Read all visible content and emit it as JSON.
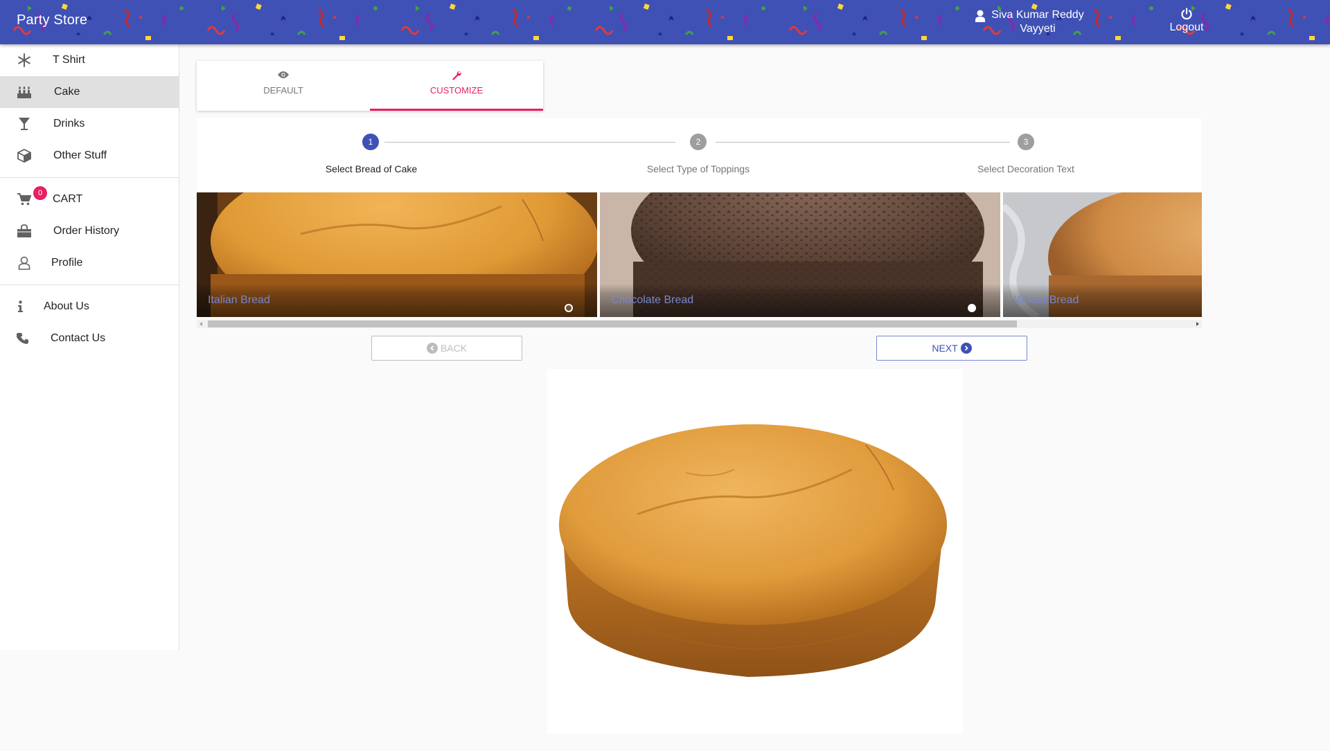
{
  "header": {
    "brand": "Party Store",
    "user_name": "Siva Kumar Reddy Vayyeti",
    "logout_label": "Logout",
    "bar_color": "#3f51b5"
  },
  "sidebar": {
    "groups": [
      {
        "items": [
          {
            "label": "T Shirt",
            "icon": "snowflake-icon"
          },
          {
            "label": "Cake",
            "icon": "birthday-cake-icon",
            "active": true
          },
          {
            "label": "Drinks",
            "icon": "cocktail-glass-icon"
          },
          {
            "label": "Other Stuff",
            "icon": "cube-icon"
          }
        ]
      },
      {
        "items": [
          {
            "label": "CART",
            "icon": "shopping-cart-icon",
            "badge": "0"
          },
          {
            "label": "Order History",
            "icon": "shopping-bag-icon"
          },
          {
            "label": "Profile",
            "icon": "user-outline-icon"
          }
        ]
      },
      {
        "items": [
          {
            "label": "About Us",
            "icon": "info-icon"
          },
          {
            "label": "Contact Us",
            "icon": "phone-icon"
          }
        ]
      }
    ]
  },
  "tabs": [
    {
      "label": "DEFAULT",
      "icon": "eye-icon",
      "selected": false
    },
    {
      "label": "CUSTOMIZE",
      "icon": "wrench-icon",
      "selected": true
    }
  ],
  "stepper": {
    "steps": [
      {
        "number": "1",
        "label": "Select Bread of Cake",
        "active": true
      },
      {
        "number": "2",
        "label": "Select Type of Toppings",
        "active": false
      },
      {
        "number": "3",
        "label": "Select Decoration Text",
        "active": false
      }
    ]
  },
  "breads": [
    {
      "title": "Italian Bread",
      "selected": true
    },
    {
      "title": "Chocolate Bread",
      "selected": false
    },
    {
      "title": "Wheat Bread",
      "selected": false
    }
  ],
  "buttons": {
    "back_label": "BACK",
    "next_label": "NEXT"
  },
  "colors": {
    "primary": "#3f51b5",
    "accent": "#e91e63"
  }
}
